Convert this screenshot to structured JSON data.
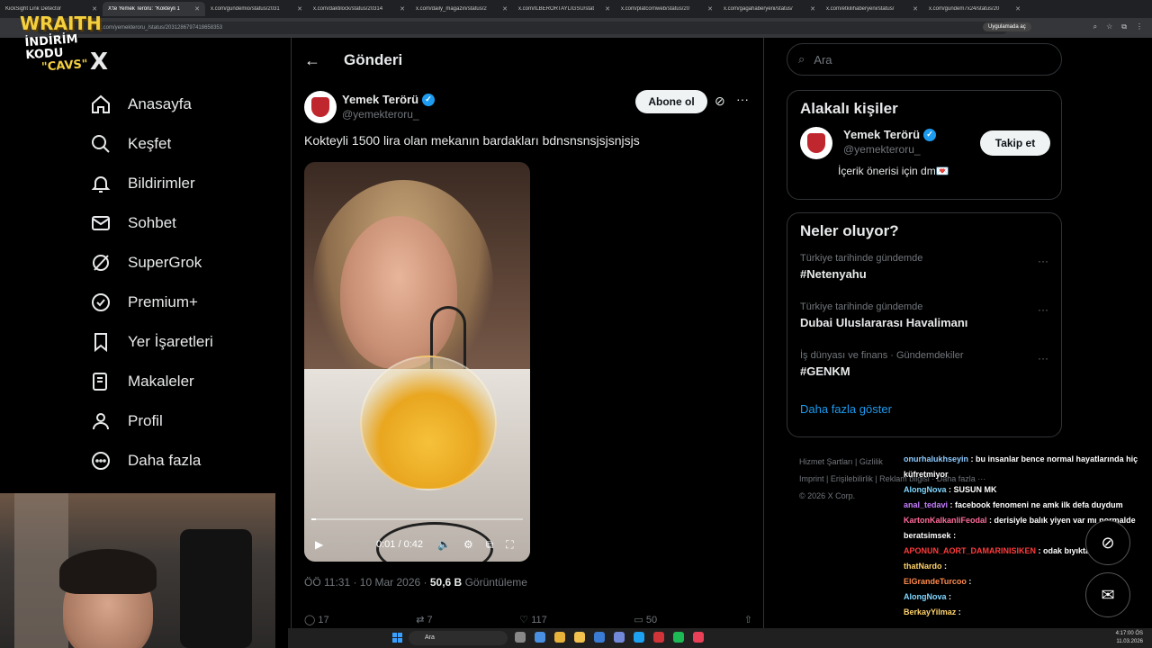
{
  "browser": {
    "tabs": [
      {
        "label": "KickSight Link Detector",
        "active": false
      },
      {
        "label": "X'te Yemek Terörü: \"Kokteyli 1",
        "active": true
      },
      {
        "label": "x.com/gundemio/status/2031",
        "active": false
      },
      {
        "label": "x.com/daktilock/status/20314",
        "active": false
      },
      {
        "label": "x.com/daily_magazin/status/2",
        "active": false
      },
      {
        "label": "x.com/ILBERORTAYLIGSU/stat",
        "active": false
      },
      {
        "label": "x.com/platcornweb/status/20",
        "active": false
      },
      {
        "label": "x.com/gagahaberyeni/status/",
        "active": false
      },
      {
        "label": "x.com/etkilihaberyeni/status/",
        "active": false
      },
      {
        "label": "x.com/gundem7x24/status/20",
        "active": false
      }
    ],
    "url": "x.com/yemekteroru_/status/2031286797418658353",
    "install_label": "Uygulamada aç"
  },
  "overlay": {
    "brand": "WRAITH",
    "promo_line1": "İNDİRİM KODU",
    "promo_line2": "\"CAVS\""
  },
  "nav": {
    "logo": "X",
    "items": [
      {
        "label": "Anasayfa",
        "icon": "home-icon"
      },
      {
        "label": "Keşfet",
        "icon": "search-icon"
      },
      {
        "label": "Bildirimler",
        "icon": "bell-icon"
      },
      {
        "label": "Sohbet",
        "icon": "mail-icon"
      },
      {
        "label": "SuperGrok",
        "icon": "grok-icon"
      },
      {
        "label": "Premium+",
        "icon": "verified-icon"
      },
      {
        "label": "Yer İşaretleri",
        "icon": "bookmark-icon"
      },
      {
        "label": "Makaleler",
        "icon": "article-icon"
      },
      {
        "label": "Profil",
        "icon": "person-icon"
      },
      {
        "label": "Daha fazla",
        "icon": "more-circle-icon"
      }
    ]
  },
  "main": {
    "header_title": "Gönderi",
    "post": {
      "display_name": "Yemek Terörü",
      "handle": "@yemekteroru_",
      "subscribe_label": "Abone ol",
      "text": "Kokteyli 1500 lira olan mekanın bardakları bdnsnsnsjsjsnjsjs",
      "video": {
        "time": "0:01 / 0:42",
        "progress": 0.02
      },
      "timestamp": "ÖÖ 11:31 · 10 Mar 2026",
      "views_count": "50,6 B",
      "views_label": "Görüntüleme",
      "actions": {
        "replies": "17",
        "reposts": "7",
        "likes": "117",
        "bookmarks": "50"
      }
    }
  },
  "right": {
    "search_placeholder": "Ara",
    "related": {
      "title": "Alakalı kişiler",
      "person": {
        "display_name": "Yemek Terörü",
        "handle": "@yemekteroru_",
        "bio": "İçerik önerisi için dm💌",
        "follow_label": "Takip et"
      }
    },
    "trends": {
      "title": "Neler oluyor?",
      "items": [
        {
          "context": "Türkiye tarihinde gündemde",
          "name": "#Netenyahu"
        },
        {
          "context": "Türkiye tarihinde gündemde",
          "name": "Dubai Uluslararası Havalimanı"
        },
        {
          "context": "İş dünyası ve finans · Gündemdekiler",
          "name": "#GENKM"
        }
      ],
      "show_more": "Daha fazla göster"
    },
    "footer": {
      "line1": "Hizmet Şartları  |  Gizlilik",
      "line2": "Imprint  |  Erişilebilirlik  |  Reklam bilgisi  ·  Daha fazla ···",
      "line3": "© 2026 X Corp."
    }
  },
  "chat": [
    {
      "user": "onurhalukhseyin",
      "color": "#8ecbff",
      "msg": ": bu insanlar bence normal hayatlarında hiç küfretmiyor"
    },
    {
      "user": "AlongNova",
      "color": "#7fd6ff",
      "msg": ": SUSUN MK"
    },
    {
      "user": "anal_tedavi",
      "color": "#c77dff",
      "msg": ": facebook fenomeni ne amk ilk defa duydum"
    },
    {
      "user": "KartonKalkanliFeodal",
      "color": "#ff6b9a",
      "msg": ": derisiyle balık yiyen var mı normalde"
    },
    {
      "user": "beratsimsek",
      "color": "#ffffff",
      "msg": ":"
    },
    {
      "user": "APONUN_AORT_DAMARINISIKEN",
      "color": "#ff3b3b",
      "msg": ": odak bıyıkta"
    },
    {
      "user": "thatNardo",
      "color": "#ffd36b",
      "msg": ":"
    },
    {
      "user": "ElGrandeTurcoo",
      "color": "#ff8a4c",
      "msg": ":"
    },
    {
      "user": "AlongNova",
      "color": "#7fd6ff",
      "msg": ":"
    },
    {
      "user": "BerkayYilmaz",
      "color": "#ffd36b",
      "msg": ":"
    }
  ],
  "taskbar": {
    "search_label": "Ara",
    "time": "4:17:00 ÖS",
    "date": "11.03.2026"
  }
}
